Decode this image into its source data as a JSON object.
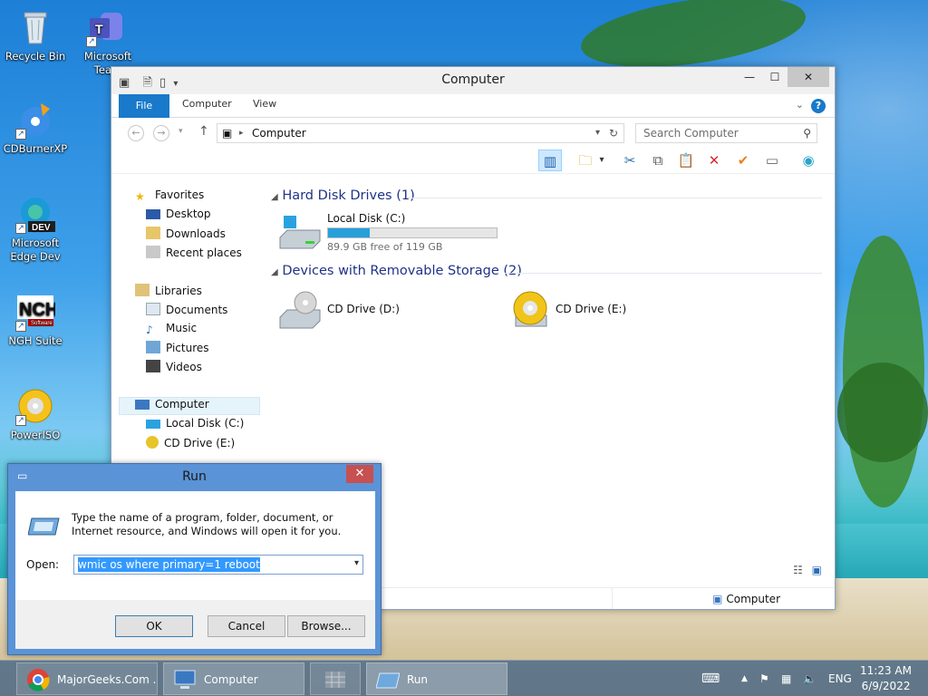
{
  "desktop": {
    "icons": [
      {
        "label": "Recycle Bin",
        "icon": "recycle-bin-icon"
      },
      {
        "label": "Microsoft Team",
        "icon": "teams-icon"
      },
      {
        "label": "CDBurnerXP",
        "icon": "cdburner-icon"
      },
      {
        "label": "Microsoft Edge Dev",
        "icon": "edge-dev-icon",
        "badge": "DEV"
      },
      {
        "label": "NGH Suite",
        "icon": "nch-icon",
        "logo": "NCH",
        "logo_sub": "Software"
      },
      {
        "label": "PowerISO",
        "icon": "poweriso-icon"
      }
    ]
  },
  "explorer": {
    "title": "Computer",
    "ribbon": {
      "file": "File",
      "tabs": [
        "Computer",
        "View"
      ],
      "help": "?"
    },
    "address": "Computer",
    "search_placeholder": "Search Computer",
    "nav": {
      "favorites": "Favorites",
      "desktop": "Desktop",
      "downloads": "Downloads",
      "recent": "Recent places",
      "libraries": "Libraries",
      "documents": "Documents",
      "music": "Music",
      "pictures": "Pictures",
      "videos": "Videos",
      "computer": "Computer",
      "local_disk": "Local Disk (C:)",
      "cd_drive": "CD Drive (E:)"
    },
    "groups": {
      "hdd": "Hard Disk Drives (1)",
      "removable": "Devices with Removable Storage (2)"
    },
    "drives": {
      "c_name": "Local Disk (C:)",
      "c_free": "89.9 GB free of 119 GB",
      "c_used_fraction": 0.245,
      "d_name": "CD Drive (D:)",
      "e_name": "CD Drive (E:)"
    },
    "status": "Computer"
  },
  "run": {
    "title": "Run",
    "description": "Type the name of a program, folder, document, or Internet resource, and Windows will open it for you.",
    "open_label": "Open:",
    "command": "wmic os where primary=1 reboot",
    "ok": "OK",
    "cancel": "Cancel",
    "browse": "Browse..."
  },
  "taskbar": {
    "items": [
      "MajorGeeks.Com ...",
      "Computer",
      "",
      "Run"
    ],
    "lang": "ENG",
    "time": "11:23 AM",
    "date": "6/9/2022"
  },
  "colors": {
    "accent": "#1979ca",
    "run_frame": "#5b93d7",
    "close_red": "#c75050",
    "usage_bar": "#26a0da",
    "group_heading": "#1e3287"
  }
}
